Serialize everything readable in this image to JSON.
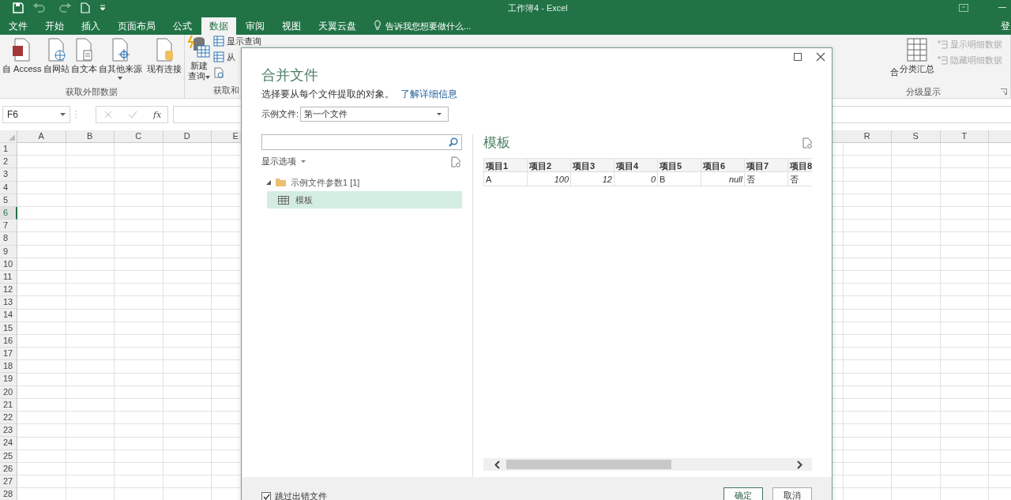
{
  "window": {
    "title": "工作簿4 - Excel"
  },
  "ribbon": {
    "tabs": [
      {
        "label": "文件",
        "selected": false
      },
      {
        "label": "开始",
        "selected": false
      },
      {
        "label": "插入",
        "selected": false
      },
      {
        "label": "页面布局",
        "selected": false
      },
      {
        "label": "公式",
        "selected": false
      },
      {
        "label": "数据",
        "selected": true
      },
      {
        "label": "审阅",
        "selected": false
      },
      {
        "label": "视图",
        "selected": false
      },
      {
        "label": "天翼云盘",
        "selected": false
      }
    ],
    "tell_me": "告诉我您想要做什么...",
    "account": "登",
    "get_external": {
      "label": "获取外部数据",
      "buttons": [
        {
          "label": "自 Access",
          "dropdown": false
        },
        {
          "label": "自网站",
          "dropdown": false
        },
        {
          "label": "自文本",
          "dropdown": false
        },
        {
          "label": "自其他来源",
          "dropdown": true
        },
        {
          "label": "现有连接",
          "dropdown": false
        }
      ]
    },
    "get_transform": {
      "label": "获取和",
      "new_query": {
        "lines": [
          "新建",
          "查询"
        ],
        "dropdown": true
      },
      "small_buttons": [
        "显示查询",
        "从"
      ]
    },
    "outline": {
      "label": "分级显示",
      "group_fragment": "合",
      "subtotal": "分类汇总",
      "small_buttons": [
        {
          "label": "显示明细数据",
          "disabled": true
        },
        {
          "label": "隐藏明细数据",
          "disabled": true
        }
      ]
    }
  },
  "formula_bar": {
    "name_box": "F6",
    "function_label": "fx"
  },
  "sheet": {
    "columns_left": [
      "A",
      "B",
      "C",
      "D",
      "E"
    ],
    "columns_right": [
      "R",
      "S",
      "T"
    ],
    "rows": [
      {
        "label": "1",
        "selected": false
      },
      {
        "label": "2",
        "selected": false
      },
      {
        "label": "3",
        "selected": false
      },
      {
        "label": "4",
        "selected": false
      },
      {
        "label": "5",
        "selected": false
      },
      {
        "label": "6",
        "selected": true
      },
      {
        "label": "7",
        "selected": false
      },
      {
        "label": "8",
        "selected": false
      },
      {
        "label": "9",
        "selected": false
      },
      {
        "label": "10",
        "selected": false
      },
      {
        "label": "11",
        "selected": false
      },
      {
        "label": "12",
        "selected": false
      },
      {
        "label": "13",
        "selected": false
      },
      {
        "label": "14",
        "selected": false
      },
      {
        "label": "15",
        "selected": false
      },
      {
        "label": "16",
        "selected": false
      },
      {
        "label": "17",
        "selected": false
      },
      {
        "label": "18",
        "selected": false
      },
      {
        "label": "19",
        "selected": false
      },
      {
        "label": "20",
        "selected": false
      },
      {
        "label": "21",
        "selected": false
      },
      {
        "label": "22",
        "selected": false
      },
      {
        "label": "23",
        "selected": false
      },
      {
        "label": "24",
        "selected": false
      },
      {
        "label": "25",
        "selected": false
      },
      {
        "label": "26",
        "selected": false
      },
      {
        "label": "27",
        "selected": false
      },
      {
        "label": "28",
        "selected": false
      }
    ]
  },
  "dialog": {
    "title": "合并文件",
    "description": "选择要从每个文件提取的对象。",
    "link": "了解详细信息",
    "sample_file": {
      "label": "示例文件:",
      "value": "第一个文件"
    },
    "display_options": "显示选项",
    "tree": [
      {
        "label": "示例文件参数1 [1]",
        "expanded": true,
        "selected": false,
        "children": [
          {
            "label": "模板",
            "selected": true
          }
        ]
      }
    ],
    "preview": {
      "title": "模板",
      "columns": [
        "项目1",
        "项目2",
        "项目3",
        "项目4",
        "项目5",
        "项目6",
        "项目7",
        "项目8"
      ],
      "rows": [
        [
          {
            "text": "A",
            "kind": "text"
          },
          {
            "text": "100",
            "kind": "number"
          },
          {
            "text": "12",
            "kind": "number"
          },
          {
            "text": "0",
            "kind": "number"
          },
          {
            "text": "B",
            "kind": "text"
          },
          {
            "text": "null",
            "kind": "null"
          },
          {
            "text": "否",
            "kind": "text"
          },
          {
            "text": "否",
            "kind": "text"
          }
        ]
      ]
    },
    "skip_errors": {
      "label": "跳过出错文件",
      "checked": true
    },
    "buttons": [
      {
        "label": "确定",
        "primary": true
      },
      {
        "label": "取消",
        "primary": false
      }
    ]
  }
}
